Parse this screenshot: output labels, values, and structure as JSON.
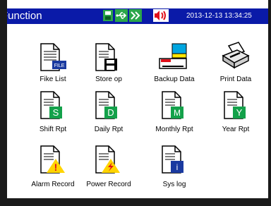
{
  "header": {
    "title": "Function",
    "datetime": "2013-12-13 13:34:25",
    "status_icons": [
      "usb-disk-icon",
      "usb-symbol-icon",
      "forward-icon",
      "speaker-icon"
    ],
    "colors": {
      "bar": "#0a1aa8",
      "status_green": "#2aa64a",
      "alarm_red": "#e0101a"
    }
  },
  "menu": {
    "items": [
      {
        "label": "Fike List",
        "icon": "file-list-icon"
      },
      {
        "label": "Store op",
        "icon": "floppy-disk-icon"
      },
      {
        "label": "Backup Data",
        "icon": "backup-data-icon"
      },
      {
        "label": "Print Data",
        "icon": "printer-icon"
      },
      {
        "label": "Shift Rpt",
        "icon": "shift-report-icon",
        "badge": "S"
      },
      {
        "label": "Daily Rpt",
        "icon": "daily-report-icon",
        "badge": "D"
      },
      {
        "label": "Monthly Rpt",
        "icon": "monthly-report-icon",
        "badge": "M"
      },
      {
        "label": "Year Rpt",
        "icon": "year-report-icon",
        "badge": "Y"
      },
      {
        "label": "Alarm Record",
        "icon": "alarm-record-icon",
        "badge": "!"
      },
      {
        "label": "Power Record",
        "icon": "power-record-icon"
      },
      {
        "label": "Sys log",
        "icon": "system-log-icon",
        "badge": "i"
      }
    ],
    "file_badge": "FILE"
  }
}
